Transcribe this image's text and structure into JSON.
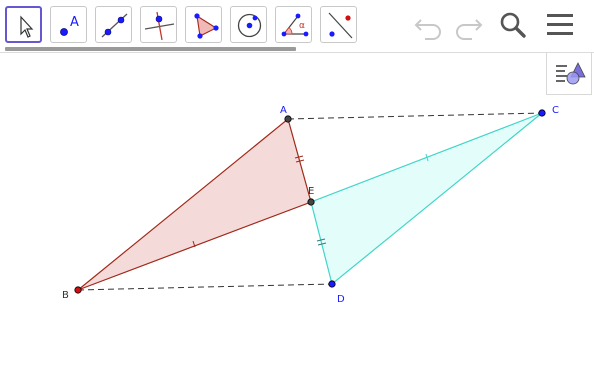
{
  "toolbar": {
    "tools": [
      {
        "name": "move-tool",
        "active": true
      },
      {
        "name": "point-tool",
        "glyph": "A"
      },
      {
        "name": "line-tool"
      },
      {
        "name": "perpendicular-line-tool"
      },
      {
        "name": "polygon-tool"
      },
      {
        "name": "circle-tool"
      },
      {
        "name": "angle-tool",
        "glyph": "α"
      },
      {
        "name": "reflect-tool"
      }
    ],
    "actions": [
      "undo-icon",
      "redo-icon",
      "search-icon",
      "menu-icon"
    ]
  },
  "colors": {
    "accent": "#6557d2",
    "triangle_abe_stroke": "#a0291a",
    "triangle_abe_fill": "#f3d3d3",
    "triangle_cde_stroke": "#3fd5c8",
    "triangle_cde_fill": "#e0fdf9",
    "point_blue": "#1a1aff",
    "point_red": "#d01010",
    "point_dark": "#444444"
  },
  "points": {
    "A": "A",
    "B": "B",
    "C": "C",
    "D": "D",
    "E": "E"
  }
}
